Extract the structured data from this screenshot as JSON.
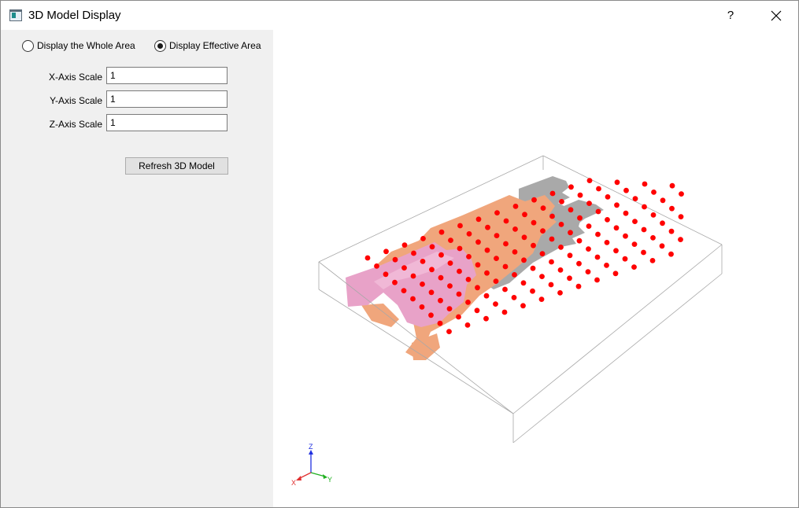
{
  "window": {
    "title": "3D Model Display",
    "help_label": "?"
  },
  "display_mode": {
    "options": [
      "Display the Whole Area",
      "Display Effective Area"
    ],
    "selected": "Display Effective Area"
  },
  "scales": {
    "x": {
      "label": "X-Axis Scale",
      "value": "1"
    },
    "y": {
      "label": "Y-Axis Scale",
      "value": "1"
    },
    "z": {
      "label": "Z-Axis Scale",
      "value": "1"
    }
  },
  "refresh_label": "Refresh 3D Model",
  "axis_triad": {
    "x": "X",
    "y": "Y",
    "z": "Z"
  },
  "colors": {
    "panel_bg": "#f0f0f0",
    "bounding_box": "#a8a8a8",
    "pink_block": "#e8a2c8",
    "orange_block": "#f0a67c",
    "gray_block": "#a9a9a9",
    "sample_points": "#ff0000",
    "axis_x": "#e03030",
    "axis_y": "#20b020",
    "axis_z": "#2030e0"
  }
}
